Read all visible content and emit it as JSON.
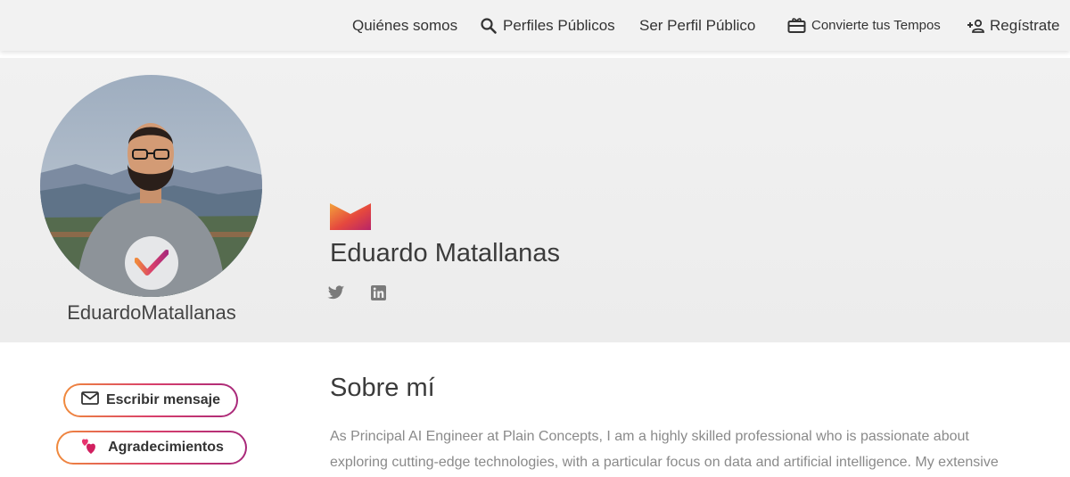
{
  "nav": {
    "about": "Quiénes somos",
    "public_profiles": "Perfiles Públicos",
    "become_public": "Ser Perfil Público",
    "convert_time": "Convierte tus Tempos",
    "register": "Regístrate"
  },
  "profile": {
    "username": "EduardoMatallanas",
    "display_name": "Eduardo Matallanas",
    "social": [
      "twitter-icon",
      "linkedin-icon"
    ]
  },
  "actions": {
    "message_label": "Escribir mensaje",
    "thanks_label": "Agradecimientos"
  },
  "about": {
    "title": "Sobre mí",
    "line1": "As Principal AI Engineer at Plain Concepts, I am a highly skilled professional who is passionate about",
    "line2": "exploring cutting-edge technologies, with a particular focus on data and artificial intelligence. My extensive"
  },
  "colors": {
    "gradient_start": "#f08a3c",
    "gradient_mid": "#d9406b",
    "gradient_end": "#a8287a",
    "nav_bg": "#f2f2f2",
    "header_bg": "#efefef"
  }
}
